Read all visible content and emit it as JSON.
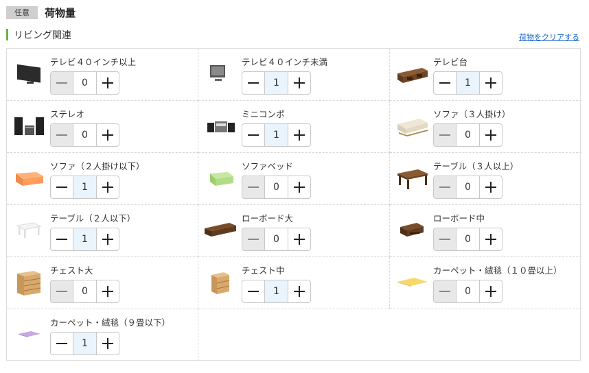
{
  "header": {
    "badge": "任意",
    "title": "荷物量"
  },
  "section": {
    "title": "リビング関連",
    "clear_link": "荷物をクリアする"
  },
  "items": [
    {
      "label": "テレビ４０インチ以上",
      "value": "0",
      "icon": "tv-large-icon"
    },
    {
      "label": "テレビ４０インチ未満",
      "value": "1",
      "icon": "tv-small-icon"
    },
    {
      "label": "テレビ台",
      "value": "1",
      "icon": "tv-stand-icon"
    },
    {
      "label": "ステレオ",
      "value": "0",
      "icon": "stereo-icon"
    },
    {
      "label": "ミニコンポ",
      "value": "1",
      "icon": "mini-component-icon"
    },
    {
      "label": "ソファ（３人掛け）",
      "value": "0",
      "icon": "sofa-3-seater-icon"
    },
    {
      "label": "ソファ（２人掛け以下）",
      "value": "1",
      "icon": "sofa-2-seater-icon"
    },
    {
      "label": "ソファベッド",
      "value": "0",
      "icon": "sofa-bed-icon"
    },
    {
      "label": "テーブル（３人以上）",
      "value": "0",
      "icon": "table-large-icon"
    },
    {
      "label": "テーブル（２人以下）",
      "value": "1",
      "icon": "table-small-icon"
    },
    {
      "label": "ローボード大",
      "value": "0",
      "icon": "lowboard-large-icon"
    },
    {
      "label": "ローボード中",
      "value": "0",
      "icon": "lowboard-medium-icon"
    },
    {
      "label": "チェスト大",
      "value": "0",
      "icon": "chest-large-icon"
    },
    {
      "label": "チェスト中",
      "value": "1",
      "icon": "chest-medium-icon"
    },
    {
      "label": "カーペット・絨毯（１０畳以上）",
      "value": "0",
      "icon": "carpet-large-icon"
    },
    {
      "label": "カーペット・絨毯（９畳以下）",
      "value": "1",
      "icon": "carpet-small-icon"
    }
  ]
}
